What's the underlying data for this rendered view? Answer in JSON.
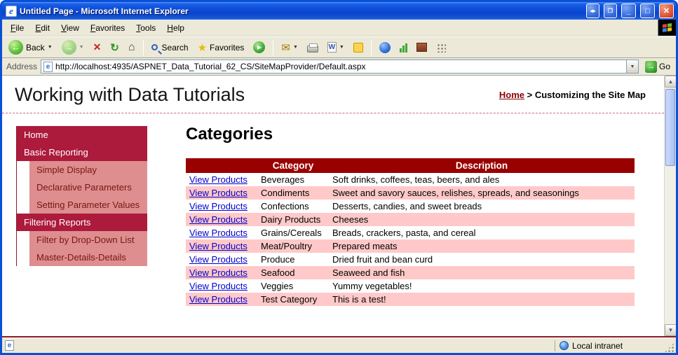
{
  "window": {
    "title": "Untitled Page - Microsoft Internet Explorer"
  },
  "menu": {
    "items": [
      "File",
      "Edit",
      "View",
      "Favorites",
      "Tools",
      "Help"
    ]
  },
  "toolbar": {
    "back_label": "Back",
    "search_label": "Search",
    "favorites_label": "Favorites"
  },
  "address_bar": {
    "label": "Address",
    "url": "http://localhost:4935/ASPNET_Data_Tutorial_62_CS/SiteMapProvider/Default.aspx",
    "go_label": "Go"
  },
  "page": {
    "site_title": "Working with Data Tutorials",
    "breadcrumb": {
      "home": "Home",
      "separator": " > ",
      "current": "Customizing the Site Map"
    },
    "sidebar": {
      "items": [
        {
          "label": "Home",
          "type": "section"
        },
        {
          "label": "Basic Reporting",
          "type": "section"
        },
        {
          "label": "Simple Display",
          "type": "sub"
        },
        {
          "label": "Declarative Parameters",
          "type": "sub"
        },
        {
          "label": "Setting Parameter Values",
          "type": "sub"
        },
        {
          "label": "Filtering Reports",
          "type": "section"
        },
        {
          "label": "Filter by Drop-Down List",
          "type": "sub"
        },
        {
          "label": "Master-Details-Details",
          "type": "sub"
        }
      ]
    },
    "main": {
      "heading": "Categories",
      "table": {
        "headers": [
          "",
          "Category",
          "Description"
        ],
        "link_label": "View Products",
        "rows": [
          {
            "category": "Beverages",
            "description": "Soft drinks, coffees, teas, beers, and ales"
          },
          {
            "category": "Condiments",
            "description": "Sweet and savory sauces, relishes, spreads, and seasonings"
          },
          {
            "category": "Confections",
            "description": "Desserts, candies, and sweet breads"
          },
          {
            "category": "Dairy Products",
            "description": "Cheeses"
          },
          {
            "category": "Grains/Cereals",
            "description": "Breads, crackers, pasta, and cereal"
          },
          {
            "category": "Meat/Poultry",
            "description": "Prepared meats"
          },
          {
            "category": "Produce",
            "description": "Dried fruit and bean curd"
          },
          {
            "category": "Seafood",
            "description": "Seaweed and fish"
          },
          {
            "category": "Veggies",
            "description": "Yummy vegetables!"
          },
          {
            "category": "Test Category",
            "description": "This is a test!"
          }
        ]
      }
    }
  },
  "status_bar": {
    "zone": "Local intranet"
  },
  "theme": {
    "header_maroon": "#990000",
    "nav_section_red": "#AC1A3C",
    "nav_sub_salmon": "#DE8E8E",
    "row_pink": "#FFC9C9",
    "link_blue": "#0000CC",
    "titlebar_blue": "#0F52DD"
  }
}
